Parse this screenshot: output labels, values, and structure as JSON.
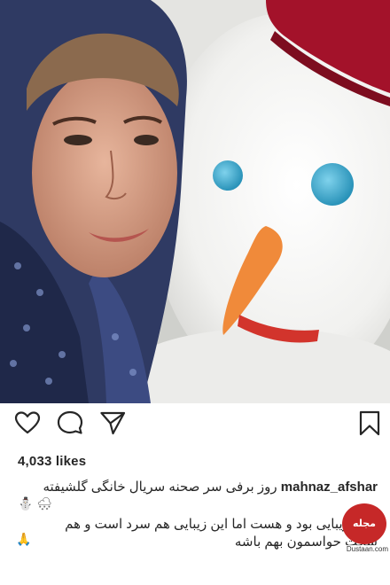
{
  "post": {
    "likes": "4,033 likes",
    "username": "mahnaz_afshar",
    "caption_head": "روز برفی سر صحنه  سریال خانگی گلشیفته",
    "caption_emojis": "⛄ 🌨",
    "caption_line1": "برف زیبایی بود و هست اما این زیبایی هم سرد است و هم",
    "caption_line2": "سخت حواسمون بهم باشه",
    "caption_pray": "🙏"
  },
  "actions": {
    "icons": [
      "heart-icon",
      "comment-icon",
      "share-icon",
      "bookmark-icon"
    ]
  },
  "watermark": {
    "logo_text": "مجله دوستان",
    "site": "Dustaan.com"
  }
}
